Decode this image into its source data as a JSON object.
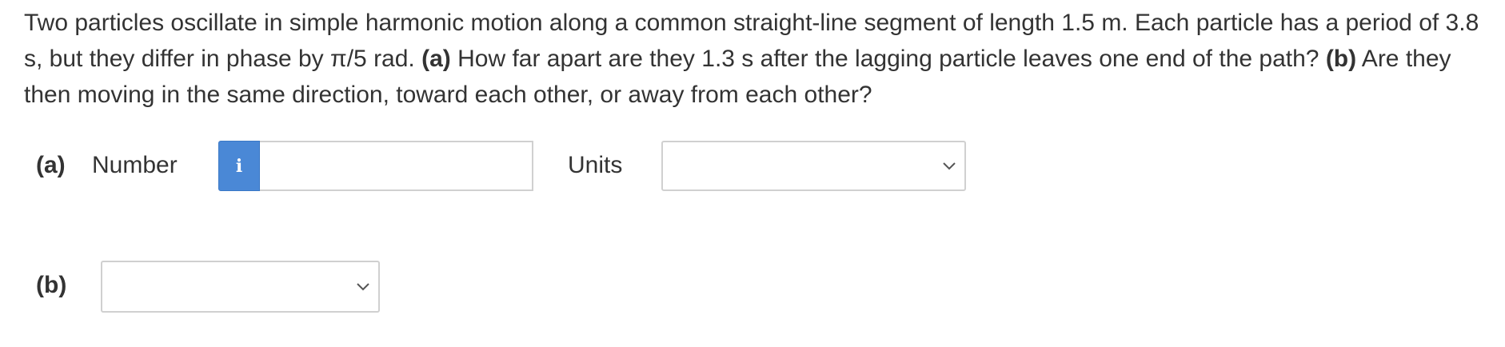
{
  "question": {
    "intro": "Two particles oscillate in simple harmonic motion along a common straight-line segment of length 1.5 m. Each particle has a period of 3.8 s, but they differ in phase by π/5 rad. ",
    "part_a_marker": "(a)",
    "part_a_text": " How far apart are they 1.3 s after the lagging particle leaves one end of the path? ",
    "part_b_marker": "(b)",
    "part_b_text": " Are they then moving in the same direction, toward each other, or away from each other?"
  },
  "answer_a": {
    "label": "(a)",
    "number_label": "Number",
    "info_icon_glyph": "i",
    "number_value": "",
    "units_label": "Units",
    "units_selected": ""
  },
  "answer_b": {
    "label": "(b)",
    "direction_selected": ""
  },
  "colors": {
    "info_button": "#4a88d6",
    "text": "#333333",
    "border": "#d0d0d0"
  }
}
